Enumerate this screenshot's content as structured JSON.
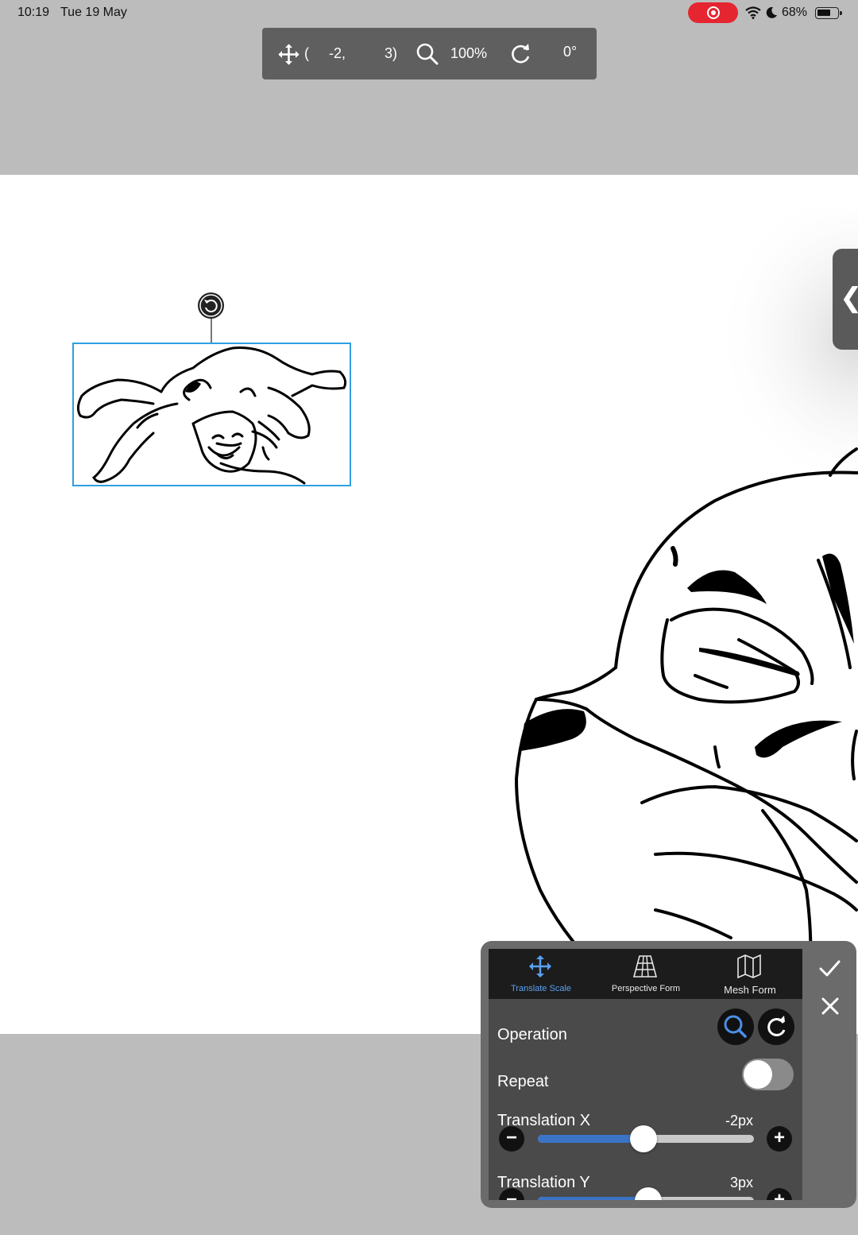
{
  "status_bar": {
    "time": "10:19",
    "date": "Tue 19 May",
    "battery_percent": "68%",
    "battery_level": 0.68,
    "icons": [
      "screen-record-icon",
      "wifi-icon",
      "moon-icon",
      "battery-icon"
    ]
  },
  "info_bar": {
    "icons": [
      "move-icon",
      "zoom-icon",
      "rotate-icon"
    ],
    "open_paren": "(",
    "x": "-2,",
    "y": "3)",
    "zoom": "100%",
    "angle": "0°"
  },
  "side_tab": {
    "glyph": "❮"
  },
  "transform_panel": {
    "tabs": [
      {
        "label": "Translate Scale",
        "icon": "move-icon",
        "active": true
      },
      {
        "label": "Perspective Form",
        "icon": "perspective-grid-icon",
        "active": false
      },
      {
        "label": "Mesh Form",
        "icon": "mesh-map-icon",
        "active": false
      }
    ],
    "operation_label": "Operation",
    "repeat_label": "Repeat",
    "repeat_on": false,
    "translation_x": {
      "label": "Translation X",
      "value": "-2px",
      "slider_fraction": 0.49
    },
    "translation_y": {
      "label": "Translation Y",
      "value": "3px",
      "slider_fraction": 0.51
    }
  },
  "colors": {
    "accent": "#3b74c6",
    "active_tab": "#5aa0f0",
    "selection": "#2e9fe0",
    "record": "#e5252f"
  }
}
